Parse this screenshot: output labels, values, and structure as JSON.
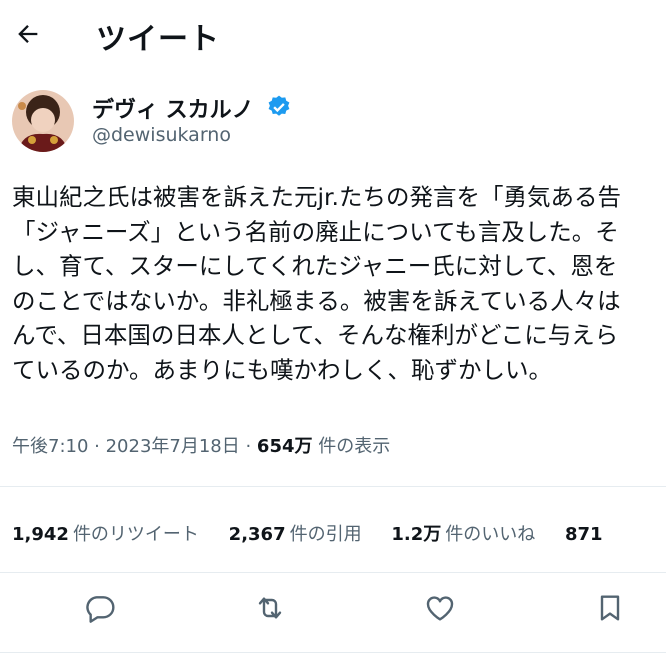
{
  "header": {
    "title": "ツイート",
    "back_icon": "arrow-left-icon"
  },
  "author": {
    "name": "デヴィ スカルノ",
    "handle": "@dewisukarno",
    "verified_icon": "verified-badge-icon",
    "badge_color": "#1d9bf0"
  },
  "tweet": {
    "lines": [
      "東山紀之氏は被害を訴えた元jr.たちの発言を「勇気ある告",
      "「ジャニーズ」という名前の廃止についても言及した。そ",
      "し、育て、スターにしてくれたジャニー氏に対して、恩を",
      "のことではないか。非礼極まる。被害を訴えている人々は",
      "んで、日本国の日本人として、そんな権利がどこに与えら",
      "ているのか。あまりにも嘆かわしく、恥ずかしい。"
    ],
    "time": "午後7:10 · 2023年7月18日 · ",
    "views": "654万",
    "views_label": " 件の表示"
  },
  "stats": {
    "retweets": {
      "value": "1,942",
      "label": "件のリツイート"
    },
    "quotes": {
      "value": "2,367",
      "label": "件の引用"
    },
    "likes": {
      "value": "1.2万",
      "label": "件のいいね"
    },
    "bookmarks": {
      "value": "871"
    }
  },
  "actions": {
    "reply_icon": "reply-icon",
    "retweet_icon": "retweet-icon",
    "like_icon": "heart-icon",
    "bookmark_icon": "bookmark-icon"
  }
}
